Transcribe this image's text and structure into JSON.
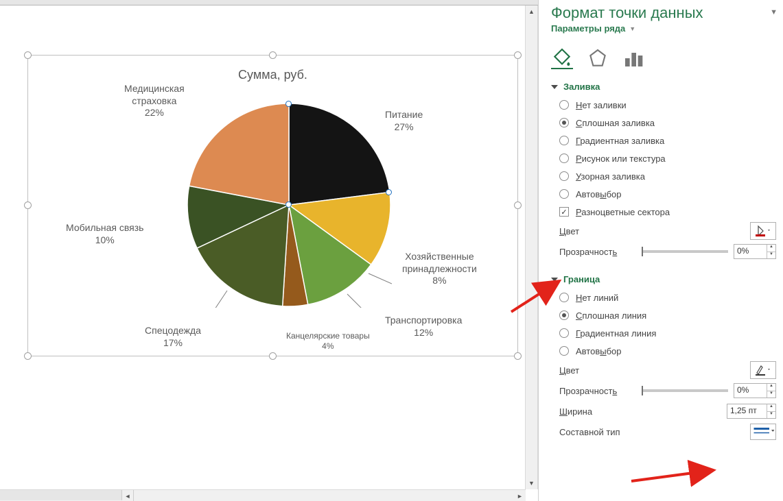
{
  "panel": {
    "title": "Формат точки данных",
    "subtitle": "Параметры ряда",
    "sections": {
      "fill": {
        "header": "Заливка",
        "options": {
          "none": "Нет заливки",
          "solid": "Сплошная заливка",
          "gradient": "Градиентная заливка",
          "picture": "Рисунок или текстура",
          "pattern": "Узорная заливка",
          "auto": "Автовыбор",
          "varycolors": "Разноцветные сектора"
        },
        "selected": "solid",
        "varycolors_checked": true,
        "color_label": "Цвет",
        "transparency_label": "Прозрачность",
        "transparency_value": "0%"
      },
      "border": {
        "header": "Граница",
        "options": {
          "none": "Нет линий",
          "solid": "Сплошная линия",
          "gradient": "Градиентная линия",
          "auto": "Автовыбор"
        },
        "selected": "solid",
        "color_label": "Цвет",
        "transparency_label": "Прозрачность",
        "transparency_value": "0%",
        "width_label": "Ширина",
        "width_value": "1,25 пт",
        "compound_label": "Составной тип"
      }
    }
  },
  "chart": {
    "title": "Сумма, руб.",
    "labels": {
      "pitanie": {
        "name": "Питание",
        "pct": "27%"
      },
      "hoz": {
        "name_l1": "Хозяйственные",
        "name_l2": "принадлежности",
        "pct": "8%"
      },
      "trans": {
        "name": "Транспортировка",
        "pct": "12%"
      },
      "kanc": {
        "name": "Канцелярские товары",
        "pct": "4%"
      },
      "spec": {
        "name": "Спецодежда",
        "pct": "17%"
      },
      "mob": {
        "name": "Мобильная связь",
        "pct": "10%"
      },
      "med": {
        "name_l1": "Медицинская",
        "name_l2": "страховка",
        "pct": "22%"
      }
    }
  },
  "chart_data": {
    "type": "pie",
    "title": "Сумма, руб.",
    "categories": [
      "Питание",
      "Хозяйственные принадлежности",
      "Транспортировка",
      "Канцелярские товары",
      "Спецодежда",
      "Мобильная связь",
      "Медицинская страховка"
    ],
    "values": [
      27,
      8,
      12,
      4,
      17,
      10,
      22
    ],
    "value_unit": "percent",
    "colors": [
      "#141414",
      "#e8b42c",
      "#6ba03f",
      "#955a1c",
      "#4a5c26",
      "#3a5224",
      "#dd8a51"
    ],
    "selected_slice_index": 0
  }
}
